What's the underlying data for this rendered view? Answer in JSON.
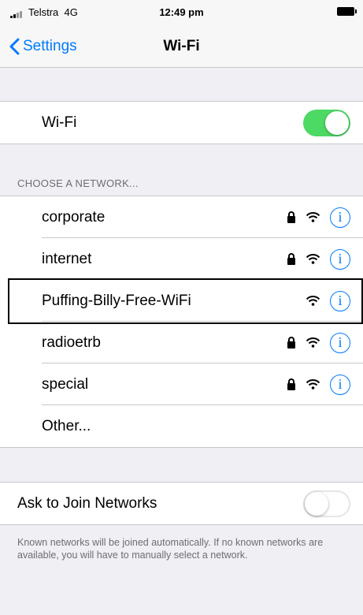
{
  "status_bar": {
    "carrier": "Telstra",
    "network_type": "4G",
    "time": "12:49 pm",
    "battery_icon": "battery-full-icon"
  },
  "nav": {
    "back_label": "Settings",
    "title": "Wi-Fi"
  },
  "wifi_toggle": {
    "label": "Wi-Fi",
    "on": true,
    "on_color": "#4cd964"
  },
  "networks": {
    "header": "CHOOSE A NETWORK...",
    "items": [
      {
        "name": "corporate",
        "locked": true
      },
      {
        "name": "internet",
        "locked": true
      },
      {
        "name": "Puffing-Billy-Free-WiFi",
        "locked": false,
        "highlighted": true
      },
      {
        "name": "radioetrb",
        "locked": true
      },
      {
        "name": "special",
        "locked": true
      }
    ],
    "other_label": "Other..."
  },
  "ask_to_join": {
    "label": "Ask to Join Networks",
    "on": false
  },
  "footer": {
    "note": "Known networks will be joined automatically. If no known networks are available, you will have to manually select a network."
  },
  "colors": {
    "accent": "#007aff",
    "background": "#efeff4"
  }
}
